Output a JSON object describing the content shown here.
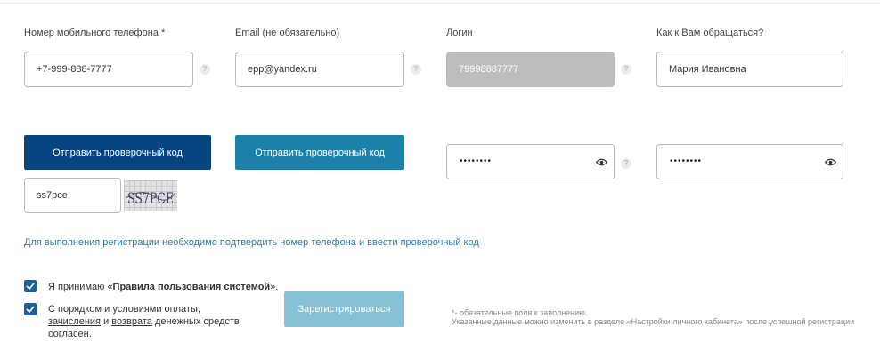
{
  "fields": {
    "phone": {
      "label": "Номер мобильного телефона *",
      "value": "+7-999-888-7777"
    },
    "email": {
      "label": "Email (не обязательно)",
      "value": "epp@yandex.ru"
    },
    "login": {
      "label": "Логин",
      "value": "79998887777"
    },
    "name": {
      "label": "Как к Вам обращаться?",
      "value": "Мария Ивановна"
    }
  },
  "help_glyph": "?",
  "buttons": {
    "send_code_primary": "Отправить проверочный код",
    "send_code_secondary": "Отправить проверочный код",
    "register": "Зарегистрироваться"
  },
  "passwords": {
    "password": "••••••••",
    "confirm": "••••••••"
  },
  "captcha": {
    "input_value": "ss7pce",
    "image_text": "SS7PCE"
  },
  "info_text": "Для выполнения регистрации необходимо подтвердить номер телефона и ввести проверочный код",
  "agreements": {
    "rules_prefix": "Я принимаю «",
    "rules_link": "Правила пользования системой",
    "rules_suffix": "».",
    "payment_line1": "С порядком и условиями оплаты,",
    "payment_link1": "зачисления",
    "payment_and": " и ",
    "payment_link2": "возврата",
    "payment_rest": " денежных средств",
    "payment_line3": "согласен."
  },
  "notes": {
    "required": "*- обязательные поля к заполнению.",
    "changeable": "Указанные данные можно изменить в разделе «Настройки личного кабинета» после успешной регистрации"
  },
  "colors": {
    "primary_button": "#04457f",
    "secondary_button": "#1a82aa",
    "register_button_disabled": "#86c1d7",
    "checkbox": "#1f5f99",
    "info_link": "#2e7aa0"
  }
}
